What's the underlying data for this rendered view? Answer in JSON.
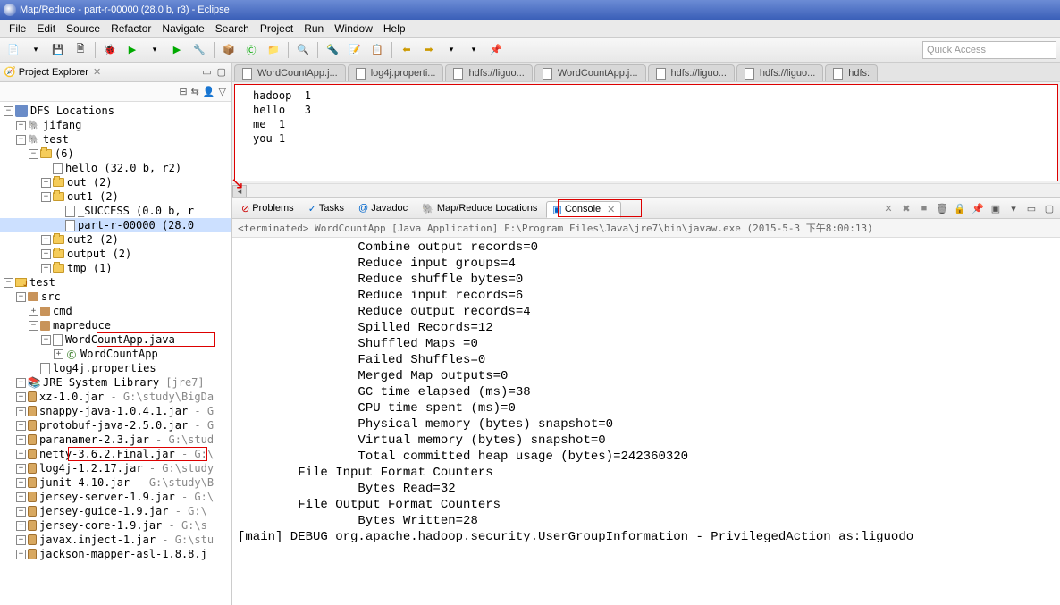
{
  "title": "Map/Reduce - part-r-00000 (28.0 b, r3) - Eclipse",
  "menu": [
    "File",
    "Edit",
    "Source",
    "Refactor",
    "Navigate",
    "Search",
    "Project",
    "Run",
    "Window",
    "Help"
  ],
  "quick_access": "Quick Access",
  "explorer": {
    "title": "Project Explorer",
    "tree": {
      "dfs": "DFS Locations",
      "jifang": "jifang",
      "test_conn": "test",
      "six": "(6)",
      "hello": "hello (32.0 b, r2)",
      "out2_a": "out (2)",
      "out1": "out1 (2)",
      "success": "_SUCCESS (0.0 b, r",
      "part": "part-r-00000 (28.0",
      "out2": "out2 (2)",
      "output": "output (2)",
      "tmp": "tmp (1)",
      "test_proj": "test",
      "src": "src",
      "cmd": "cmd",
      "mapreduce": "mapreduce",
      "wca_java": "WordCountApp.java",
      "wca_class": "WordCountApp",
      "log4j": "log4j.properties",
      "jre": "JRE System Library",
      "jre_ver": "[jre7]",
      "jar_xz": "xz-1.0.jar",
      "jar_xz_loc": " - G:\\study\\BigDa",
      "jar_snappy": "snappy-java-1.0.4.1.jar",
      "jar_snappy_loc": " - G",
      "jar_protobuf": "protobuf-java-2.5.0.jar",
      "jar_protobuf_loc": " - G",
      "jar_paranamer": "paranamer-2.3.jar",
      "jar_paranamer_loc": " - G:\\stud",
      "jar_netty": "netty-3.6.2.Final.jar",
      "jar_netty_loc": " - G:\\",
      "jar_log4j": "log4j-1.2.17.jar",
      "jar_log4j_loc": " - G:\\study",
      "jar_junit": "junit-4.10.jar",
      "jar_junit_loc": " - G:\\study\\B",
      "jar_jserver": "jersey-server-1.9.jar",
      "jar_jserver_loc": " - G:\\",
      "jar_jguice": "jersey-guice-1.9.jar",
      "jar_jguice_loc": " - G:\\",
      "jar_jcore": "jersey-core-1.9.jar",
      "jar_jcore_loc": " - G:\\s",
      "jar_javax": "javax.inject-1.jar",
      "jar_javax_loc": " - G:\\stu",
      "jar_jackson": "jackson-mapper-asl-1.8.8.j"
    }
  },
  "editor_tabs": [
    "WordCountApp.j...",
    "log4j.properti...",
    "hdfs://liguo...",
    "WordCountApp.j...",
    "hdfs://liguo...",
    "hdfs://liguo...",
    "hdfs:"
  ],
  "editor_content": [
    "hadoop  1",
    "hello   3",
    "me  1",
    "you 1"
  ],
  "bottom_tabs": {
    "problems": "Problems",
    "tasks": "Tasks",
    "javadoc": "Javadoc",
    "mapreduce": "Map/Reduce Locations",
    "console": "Console"
  },
  "console_header": "<terminated> WordCountApp [Java Application] F:\\Program Files\\Java\\jre7\\bin\\javaw.exe (2015-5-3 下午8:00:13)",
  "console_body": "                Combine output records=0\n                Reduce input groups=4\n                Reduce shuffle bytes=0\n                Reduce input records=6\n                Reduce output records=4\n                Spilled Records=12\n                Shuffled Maps =0\n                Failed Shuffles=0\n                Merged Map outputs=0\n                GC time elapsed (ms)=38\n                CPU time spent (ms)=0\n                Physical memory (bytes) snapshot=0\n                Virtual memory (bytes) snapshot=0\n                Total committed heap usage (bytes)=242360320\n        File Input Format Counters \n                Bytes Read=32\n        File Output Format Counters \n                Bytes Written=28\n[main] DEBUG org.apache.hadoop.security.UserGroupInformation - PrivilegedAction as:liguodo"
}
